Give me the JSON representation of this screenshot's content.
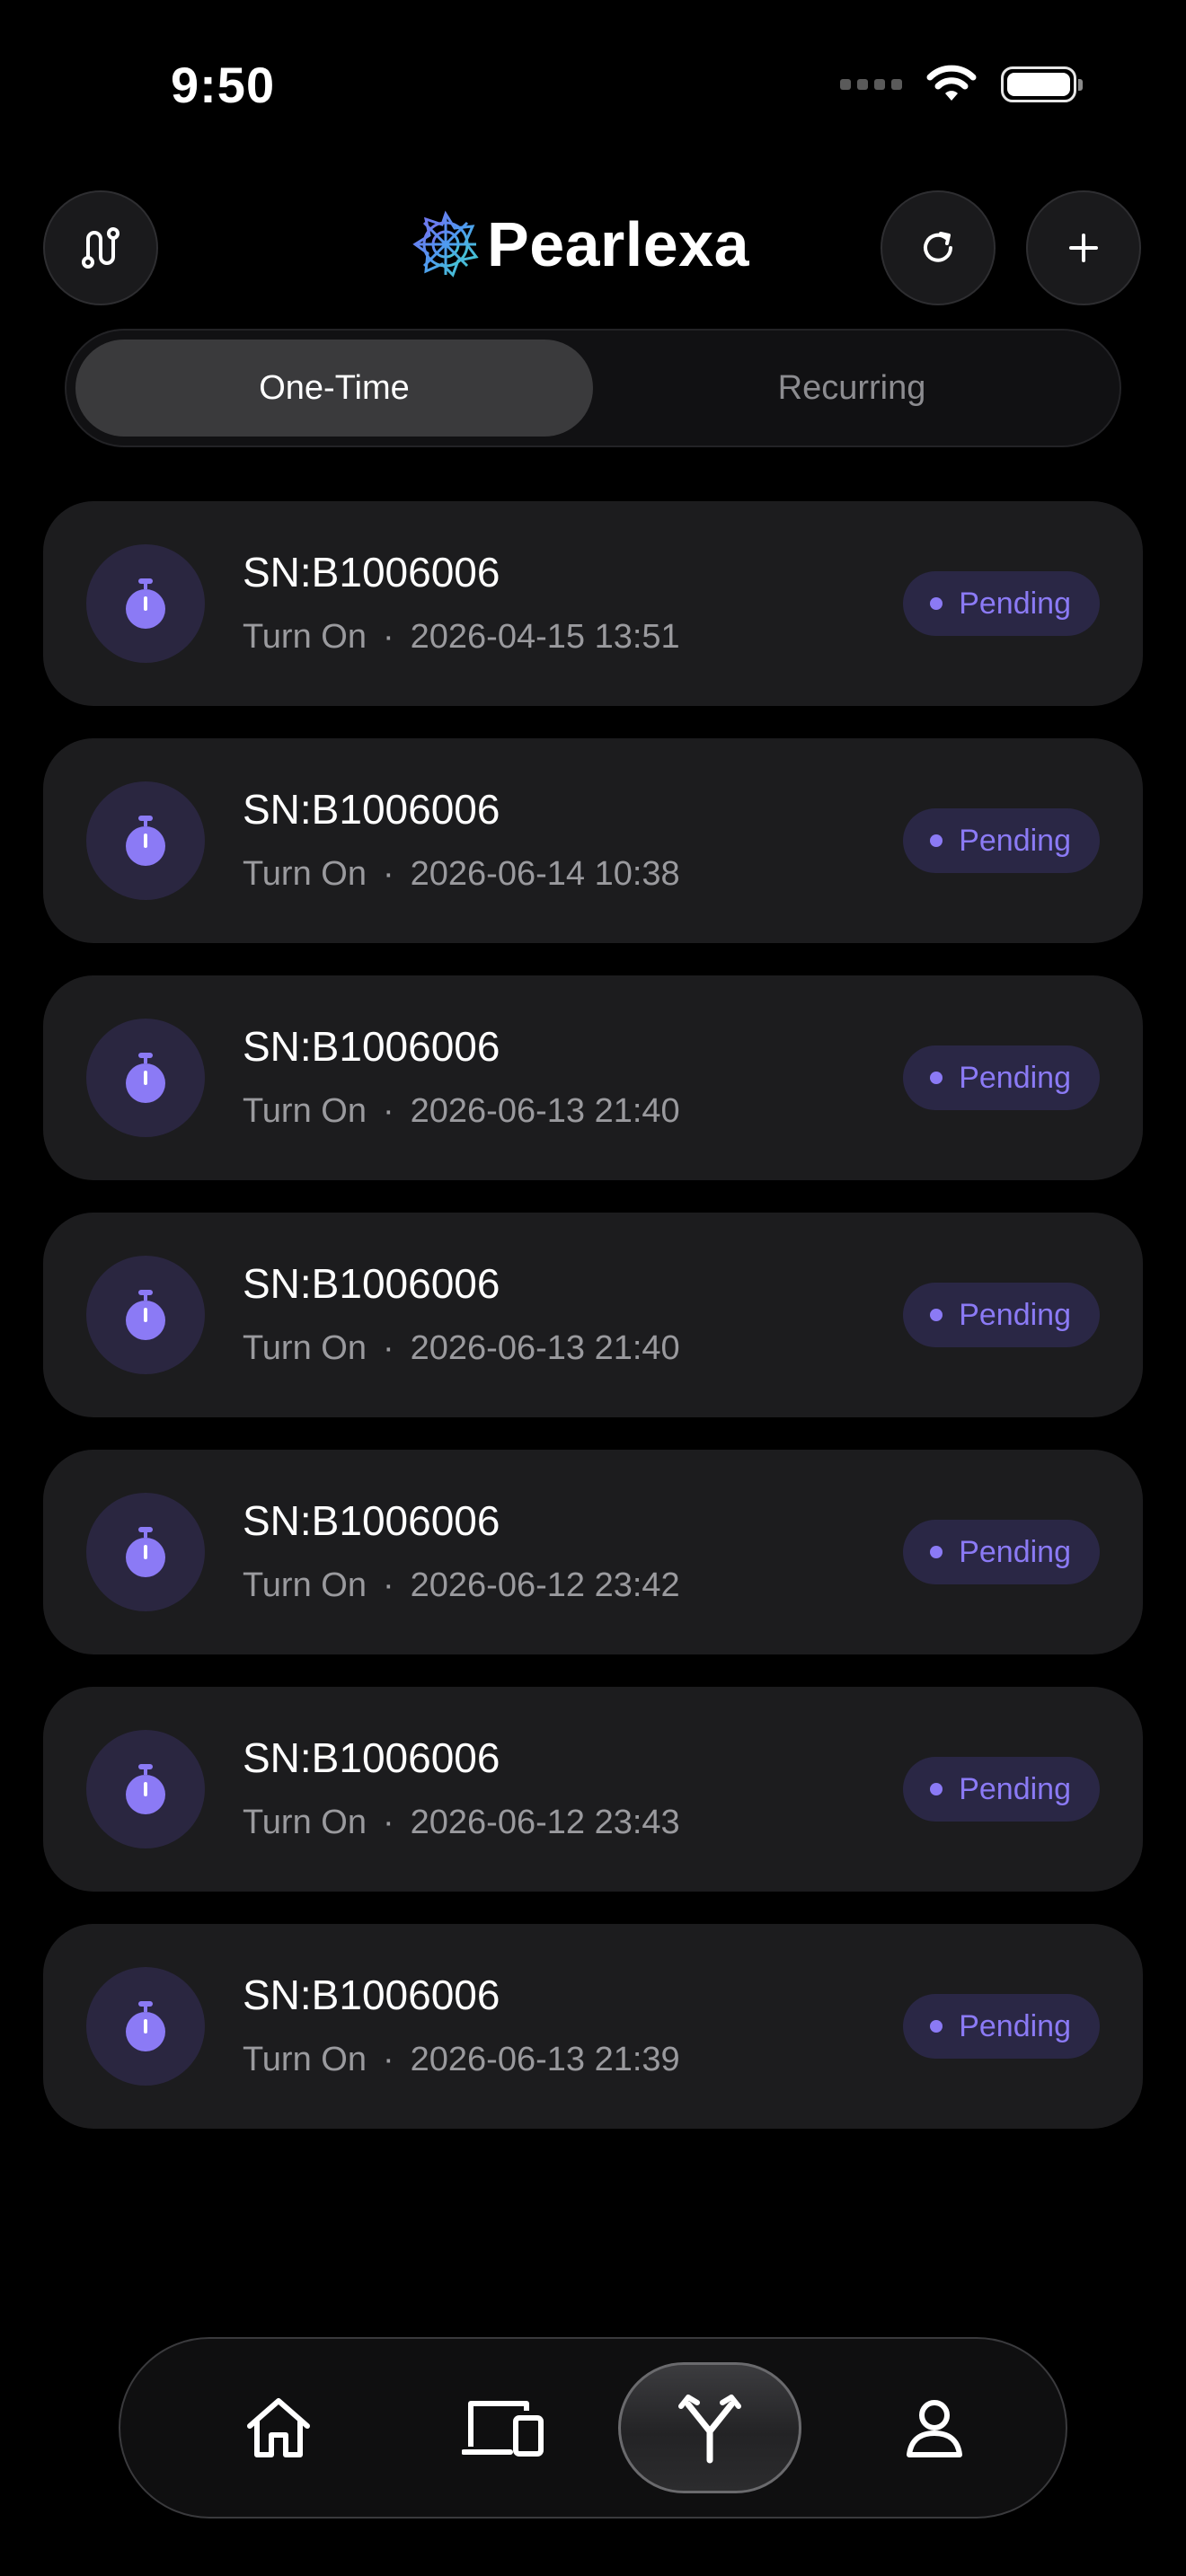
{
  "status_bar": {
    "time": "9:50"
  },
  "header": {
    "app_name": "Pearlexa"
  },
  "segmented": {
    "tabs": [
      {
        "label": "One-Time",
        "active": true
      },
      {
        "label": "Recurring",
        "active": false
      }
    ]
  },
  "tasks": [
    {
      "title": "SN:B1006006",
      "action": "Turn On",
      "separator": "·",
      "datetime": "2026-04-15 13:51",
      "status": "Pending"
    },
    {
      "title": "SN:B1006006",
      "action": "Turn On",
      "separator": "·",
      "datetime": "2026-06-14 10:38",
      "status": "Pending"
    },
    {
      "title": "SN:B1006006",
      "action": "Turn On",
      "separator": "·",
      "datetime": "2026-06-13 21:40",
      "status": "Pending"
    },
    {
      "title": "SN:B1006006",
      "action": "Turn On",
      "separator": "·",
      "datetime": "2026-06-13 21:40",
      "status": "Pending"
    },
    {
      "title": "SN:B1006006",
      "action": "Turn On",
      "separator": "·",
      "datetime": "2026-06-12 23:42",
      "status": "Pending"
    },
    {
      "title": "SN:B1006006",
      "action": "Turn On",
      "separator": "·",
      "datetime": "2026-06-12 23:43",
      "status": "Pending"
    },
    {
      "title": "SN:B1006006",
      "action": "Turn On",
      "separator": "·",
      "datetime": "2026-06-13 21:39",
      "status": "Pending"
    }
  ],
  "tabbar": {
    "items": [
      {
        "icon": "home-icon",
        "active": false
      },
      {
        "icon": "devices-icon",
        "active": false
      },
      {
        "icon": "automation-icon",
        "active": true
      },
      {
        "icon": "profile-icon",
        "active": false
      }
    ]
  },
  "colors": {
    "background": "#000000",
    "card": "#1c1c1e",
    "accent": "#8b7af5",
    "badge_bg": "#2a2745",
    "icon_circle": "#2a2640"
  }
}
